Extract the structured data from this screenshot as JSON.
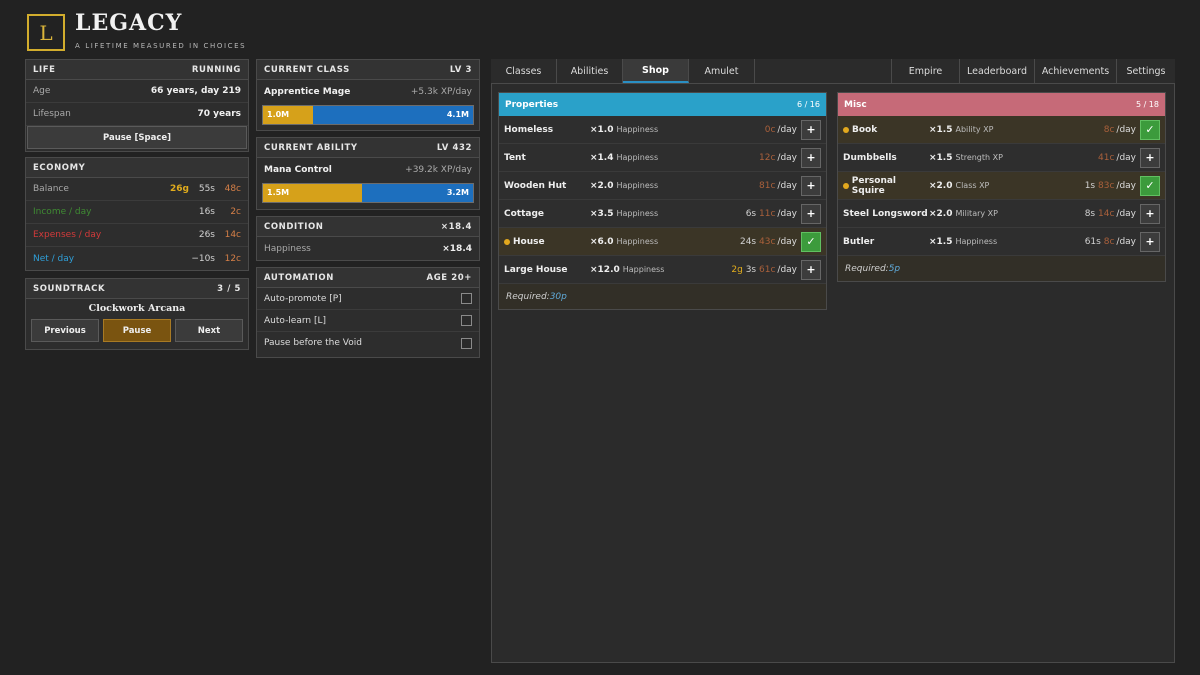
{
  "header": {
    "logo_letter": "L",
    "title": "LEGACY",
    "tagline": "A LIFETIME MEASURED IN CHOICES"
  },
  "life": {
    "title": "LIFE",
    "status": "RUNNING",
    "age_label": "Age",
    "age_value": "66 years, day 219",
    "lifespan_label": "Lifespan",
    "lifespan_value": "70 years",
    "pause_label": "Pause [Space]"
  },
  "economy": {
    "title": "ECONOMY",
    "balance": {
      "label": "Balance",
      "g": "26g",
      "s": "55s",
      "c": "48c"
    },
    "income": {
      "label": "Income / day",
      "s": "16s",
      "c": "2c",
      "color": "#3f8a33"
    },
    "expenses": {
      "label": "Expenses / day",
      "s": "26s",
      "c": "14c",
      "color": "#d23a3a"
    },
    "net": {
      "label": "Net / day",
      "s": "−10s",
      "c": "12c",
      "color": "#2f9fd8"
    }
  },
  "soundtrack": {
    "title": "SOUNDTRACK",
    "count": "3 / 5",
    "track": "Clockwork Arcana",
    "prev": "Previous",
    "pause": "Pause",
    "next": "Next"
  },
  "current_class": {
    "title": "CURRENT CLASS",
    "level": "LV 3",
    "name": "Apprentice Mage",
    "rate": "+5.3k XP/day",
    "xp": "1.0M",
    "xp_max": "4.1M",
    "progress": 0.24
  },
  "current_ability": {
    "title": "CURRENT ABILITY",
    "level": "LV 432",
    "name": "Mana Control",
    "rate": "+39.2k XP/day",
    "xp": "1.5M",
    "xp_max": "3.2M",
    "progress": 0.47
  },
  "condition": {
    "title": "CONDITION",
    "mult": "×18.4",
    "happiness_label": "Happiness",
    "happiness_value": "×18.4"
  },
  "automation": {
    "title": "AUTOMATION",
    "age": "AGE 20+",
    "items": [
      {
        "label": "Auto-promote [P]"
      },
      {
        "label": "Auto-learn [L]"
      },
      {
        "label": "Pause before the Void"
      }
    ]
  },
  "tabs": {
    "left": [
      "Classes",
      "Abilities",
      "Shop",
      "Amulet"
    ],
    "right": [
      "Empire",
      "Leaderboard",
      "Achievements",
      "Settings"
    ],
    "active": "Shop"
  },
  "properties": {
    "title": "Properties",
    "count": "6 / 16",
    "color": "#2aa1c9",
    "items": [
      {
        "name": "Homeless",
        "mult": "×1.0",
        "effect": "Happiness",
        "g": "",
        "s": "",
        "c": "0c",
        "per": "/day",
        "owned": false,
        "active": false
      },
      {
        "name": "Tent",
        "mult": "×1.4",
        "effect": "Happiness",
        "g": "",
        "s": "",
        "c": "12c",
        "per": "/day",
        "owned": false,
        "active": false
      },
      {
        "name": "Wooden Hut",
        "mult": "×2.0",
        "effect": "Happiness",
        "g": "",
        "s": "",
        "c": "81c",
        "per": "/day",
        "owned": false,
        "active": false
      },
      {
        "name": "Cottage",
        "mult": "×3.5",
        "effect": "Happiness",
        "g": "",
        "s": "6s",
        "c": "11c",
        "per": "/day",
        "owned": false,
        "active": false
      },
      {
        "name": "House",
        "mult": "×6.0",
        "effect": "Happiness",
        "g": "",
        "s": "24s",
        "c": "43c",
        "per": "/day",
        "owned": true,
        "active": true
      },
      {
        "name": "Large House",
        "mult": "×12.0",
        "effect": "Happiness",
        "g": "2g",
        "s": "3s",
        "c": "61c",
        "per": "/day",
        "owned": false,
        "active": false
      }
    ],
    "required_label": "Required:",
    "required_value": "30p"
  },
  "misc": {
    "title": "Misc",
    "count": "5 / 18",
    "color": "#c66a78",
    "items": [
      {
        "name": "Book",
        "mult": "×1.5",
        "effect": "Ability XP",
        "g": "",
        "s": "",
        "c": "8c",
        "per": "/day",
        "owned": true,
        "active": true
      },
      {
        "name": "Dumbbells",
        "mult": "×1.5",
        "effect": "Strength XP",
        "g": "",
        "s": "",
        "c": "41c",
        "per": "/day",
        "owned": false,
        "active": false
      },
      {
        "name": "Personal Squire",
        "mult": "×2.0",
        "effect": "Class XP",
        "g": "",
        "s": "1s",
        "c": "83c",
        "per": "/day",
        "owned": true,
        "active": true
      },
      {
        "name": "Steel Longsword",
        "mult": "×2.0",
        "effect": "Military XP",
        "g": "",
        "s": "8s",
        "c": "14c",
        "per": "/day",
        "owned": false,
        "active": false
      },
      {
        "name": "Butler",
        "mult": "×1.5",
        "effect": "Happiness",
        "g": "",
        "s": "61s",
        "c": "8c",
        "per": "/day",
        "owned": false,
        "active": false
      }
    ],
    "required_label": "Required:",
    "required_value": "5p"
  },
  "icons": {
    "buy": "plus-icon",
    "owned": "check-icon",
    "active": "active-dot-icon"
  }
}
